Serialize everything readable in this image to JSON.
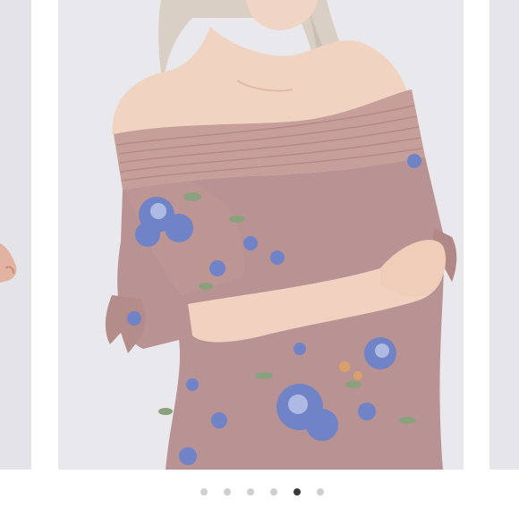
{
  "carousel": {
    "slide_count": 6,
    "active_index": 4,
    "dot_color": "#cfcfd2",
    "active_dot_color": "#3a3a3c"
  },
  "product_image": {
    "garment_color": "#b99393",
    "flower_color": "#6f83c6",
    "leaf_color": "#8aa27c",
    "background_color": "#e9e8ec"
  }
}
